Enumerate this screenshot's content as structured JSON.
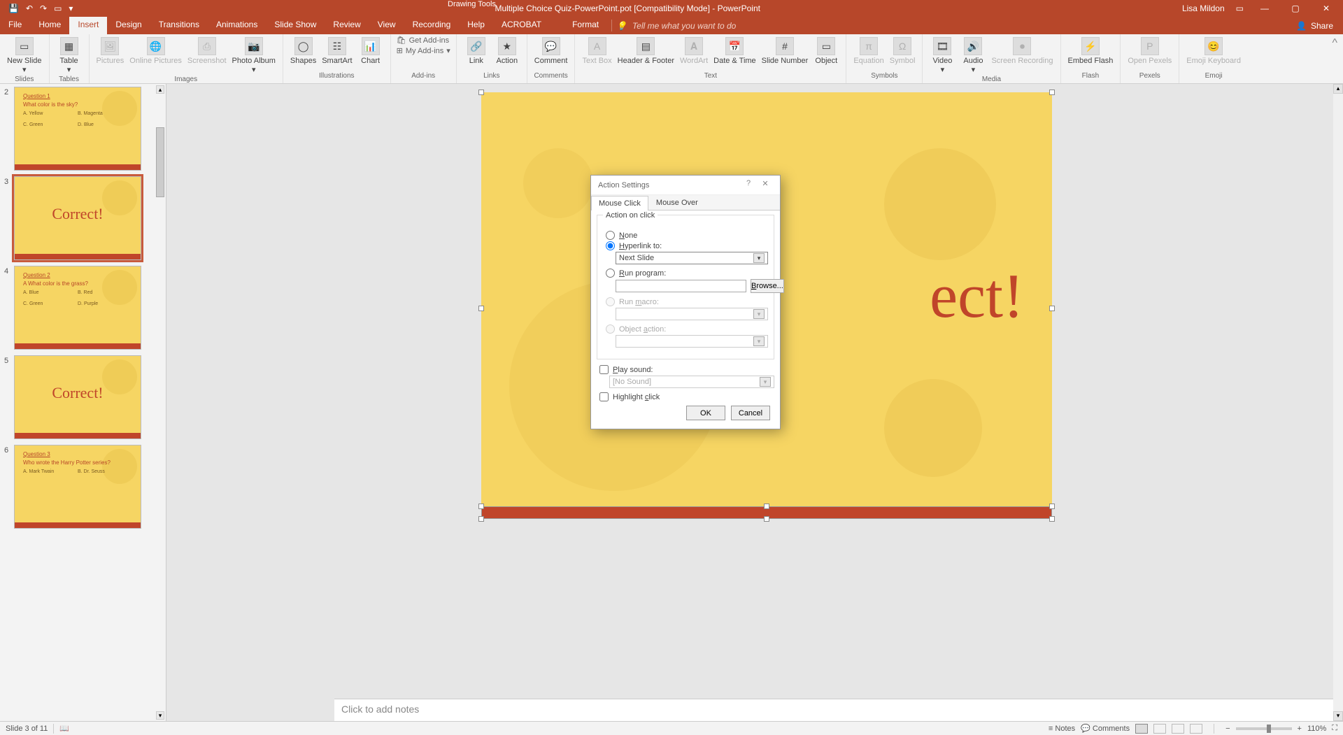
{
  "titlebar": {
    "doc_title": "Multiple Choice Quiz-PowerPoint.pot [Compatibility Mode]  -  PowerPoint",
    "context_title": "Drawing Tools",
    "user": "Lisa Mildon"
  },
  "tabs": {
    "file": "File",
    "home": "Home",
    "insert": "Insert",
    "design": "Design",
    "transitions": "Transitions",
    "animations": "Animations",
    "slideshow": "Slide Show",
    "review": "Review",
    "view": "View",
    "recording": "Recording",
    "help": "Help",
    "acrobat": "ACROBAT",
    "format": "Format",
    "tellme": "Tell me what you want to do",
    "share": "Share"
  },
  "ribbon": {
    "slides": {
      "new_slide": "New Slide",
      "group": "Slides"
    },
    "tables": {
      "table": "Table",
      "group": "Tables"
    },
    "images": {
      "pictures": "Pictures",
      "online": "Online Pictures",
      "screenshot": "Screenshot",
      "album": "Photo Album",
      "group": "Images"
    },
    "illustrations": {
      "shapes": "Shapes",
      "smartart": "SmartArt",
      "chart": "Chart",
      "group": "Illustrations"
    },
    "addins": {
      "get": "Get Add-ins",
      "my": "My Add-ins",
      "group": "Add-ins"
    },
    "links": {
      "link": "Link",
      "action": "Action",
      "group": "Links"
    },
    "comments": {
      "comment": "Comment",
      "group": "Comments"
    },
    "text": {
      "textbox": "Text Box",
      "header": "Header & Footer",
      "wordart": "WordArt",
      "datetime": "Date & Time",
      "slidenum": "Slide Number",
      "object": "Object",
      "group": "Text"
    },
    "symbols": {
      "equation": "Equation",
      "symbol": "Symbol",
      "group": "Symbols"
    },
    "media": {
      "video": "Video",
      "audio": "Audio",
      "screen": "Screen Recording",
      "group": "Media"
    },
    "flash": {
      "embed": "Embed Flash",
      "group": "Flash"
    },
    "pexels": {
      "open": "Open Pexels",
      "group": "Pexels"
    },
    "emoji": {
      "kb": "Emoji Keyboard",
      "group": "Emoji"
    }
  },
  "thumbs": [
    {
      "num": "2",
      "title": "Question 1",
      "body": "What color is the sky?",
      "a": "A.   Yellow",
      "b": "B.   Magenta",
      "c": "C.   Green",
      "d": "D.   Blue"
    },
    {
      "num": "3",
      "big": "Correct!",
      "selected": true
    },
    {
      "num": "4",
      "title": "Question 2",
      "body": "A What color is the grass?",
      "a": "A.   Blue",
      "b": "B.   Red",
      "c": "C.   Green",
      "d": "D.   Purple"
    },
    {
      "num": "5",
      "big": "Correct!"
    },
    {
      "num": "6",
      "title": "Question 3",
      "body": "Who wrote the Harry Potter series?",
      "a": "A.   Mark Twain",
      "b": "B.   Dr. Seuss"
    }
  ],
  "slide": {
    "text": "ect!"
  },
  "notes": {
    "placeholder": "Click to add notes"
  },
  "status": {
    "pos": "Slide 3 of 11",
    "notes": "Notes",
    "comments": "Comments",
    "zoom": "110%"
  },
  "dialog": {
    "title": "Action Settings",
    "tab_click": "Mouse Click",
    "tab_over": "Mouse Over",
    "legend": "Action on click",
    "none": "None",
    "hyperlink": "Hyperlink to:",
    "hyperlink_value": "Next Slide",
    "runprogram": "Run program:",
    "browse": "Browse...",
    "runmacro": "Run macro:",
    "objectaction": "Object action:",
    "playsound": "Play sound:",
    "sound_value": "[No Sound]",
    "highlight": "Highlight click",
    "ok": "OK",
    "cancel": "Cancel"
  }
}
